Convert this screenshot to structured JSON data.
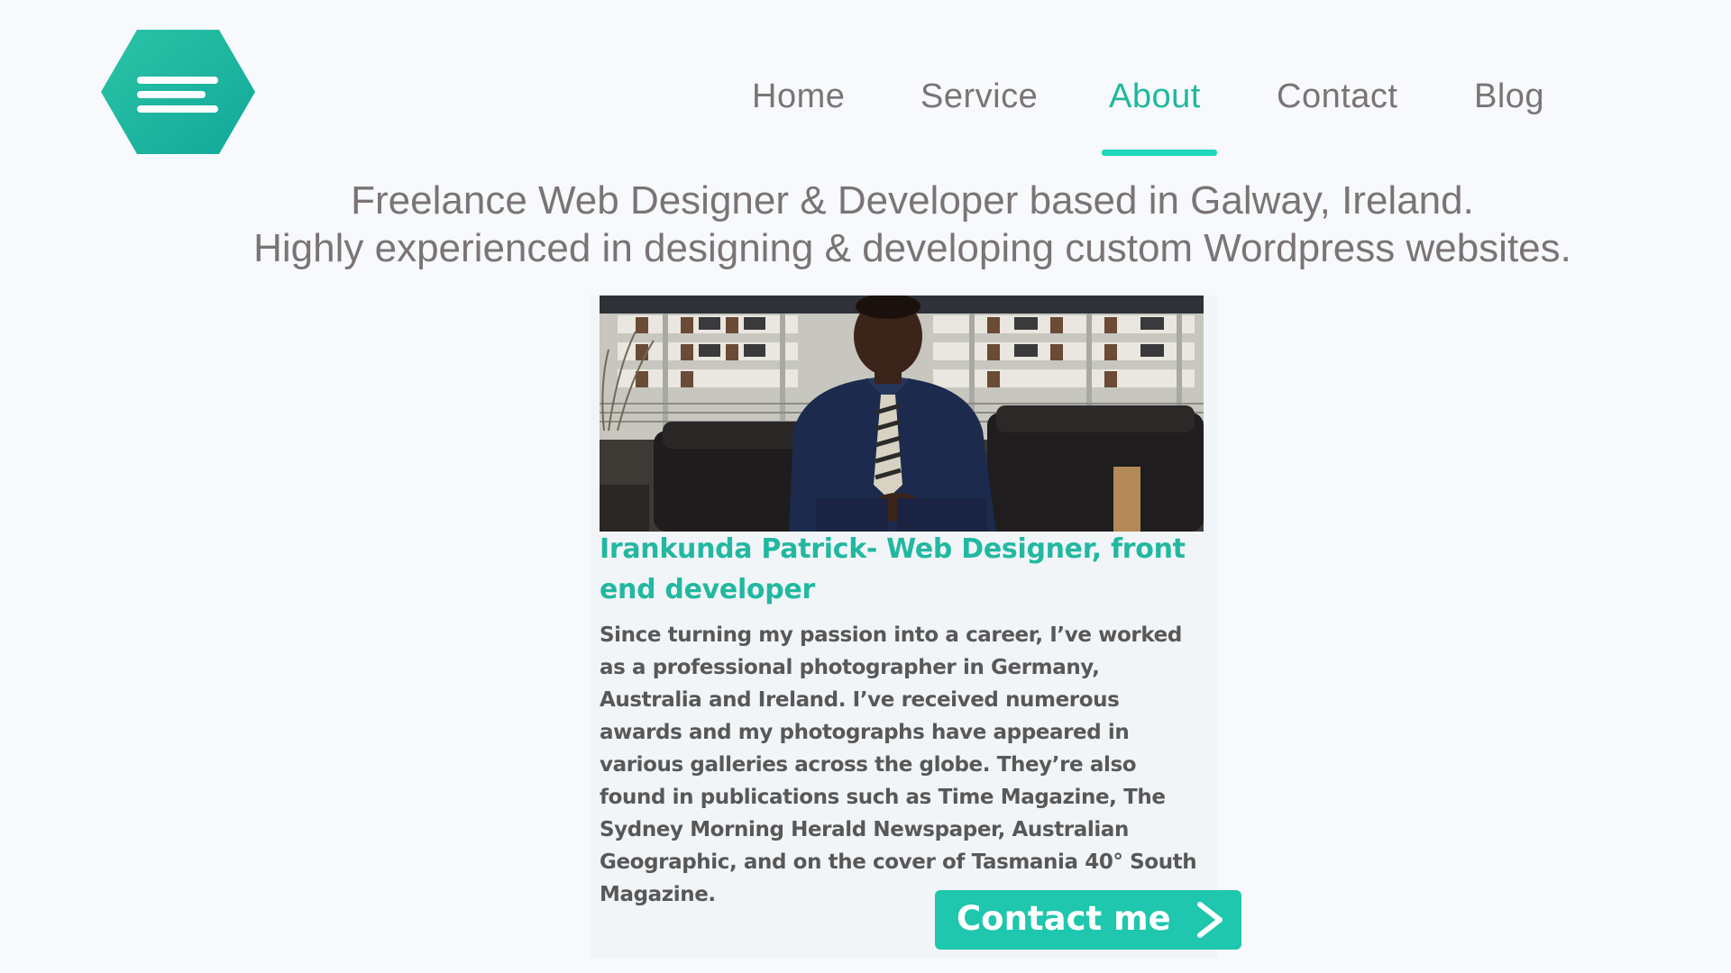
{
  "nav": {
    "items": [
      {
        "label": "Home"
      },
      {
        "label": "Service"
      },
      {
        "label": "About"
      },
      {
        "label": "Contact"
      },
      {
        "label": "Blog"
      }
    ],
    "active": "About"
  },
  "logo": {
    "icon": "hamburger-menu-icon",
    "color_from": "#2cc4a6",
    "color_to": "#12a89a"
  },
  "tagline": {
    "line1": "Freelance Web Designer & Developer based in Galway, Ireland.",
    "line2": "Highly experienced in designing & developing custom Wordpress websites."
  },
  "profile": {
    "name_title": "Irankunda Patrick- Web Designer, front end developer",
    "bio": "Since turning my passion into a career, I’ve worked as a professional photographer in Germany, Australia and Ireland. I’ve received numerous awards and my photographs have appeared in various galleries across the globe. They’re also found in publications such as Time Magazine, The Sydney Morning Herald Newspaper, Australian Geographic, and on the cover of Tasmania 40° South Magazine."
  },
  "contact_button": {
    "label": "Contact me",
    "icon": "chevron-right-icon"
  },
  "colors": {
    "accent": "#1fb89f",
    "underline": "#1fd6bb",
    "button": "#1ec7ad",
    "text": "#7b7474",
    "body_text": "#585858",
    "background": "#f7f9fc"
  }
}
